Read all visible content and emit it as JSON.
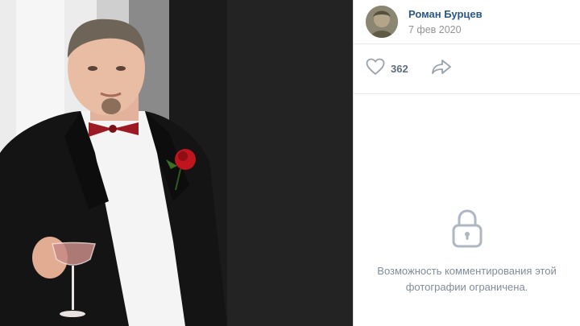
{
  "post": {
    "author_name": "Роман Бурцев",
    "date": "7 фев 2020",
    "likes": "362"
  },
  "comments": {
    "restricted_text": "Возможность комментирования этой\nфотографии ограничена."
  },
  "icons": {
    "like": "heart-icon",
    "share": "share-arrow-icon",
    "lock": "lock-icon"
  },
  "colors": {
    "link": "#2a5885",
    "muted": "#939393",
    "icon": "#99a2ad"
  }
}
